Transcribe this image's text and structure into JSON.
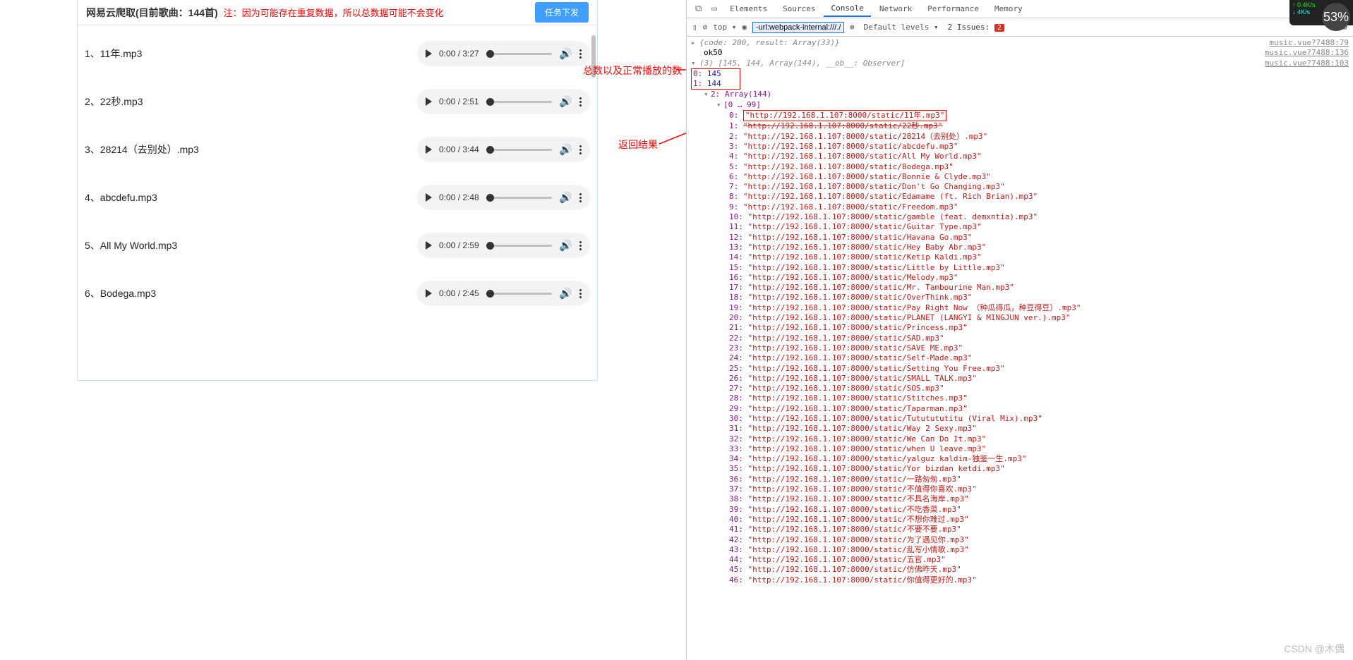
{
  "header": {
    "title_prefix": "网易云爬取(目前歌曲：",
    "count": "144",
    "title_suffix": "首)",
    "note": "注：因为可能存在重复数据，所以总数据可能不会变化",
    "button": "任务下发"
  },
  "songs": [
    {
      "idx": "1",
      "name": "11年.mp3",
      "time": "0:00 / 3:27"
    },
    {
      "idx": "2",
      "name": "22秒.mp3",
      "time": "0:00 / 2:51"
    },
    {
      "idx": "3",
      "name": "28214（去别处）.mp3",
      "time": "0:00 / 3:44"
    },
    {
      "idx": "4",
      "name": "abcdefu.mp3",
      "time": "0:00 / 2:48"
    },
    {
      "idx": "5",
      "name": "All My World.mp3",
      "time": "0:00 / 2:59"
    },
    {
      "idx": "6",
      "name": "Bodega.mp3",
      "time": "0:00 / 2:45"
    }
  ],
  "annotations": {
    "a1": "总数以及正常播放的数",
    "a2": "返回结果"
  },
  "devtools": {
    "tabs": [
      "Elements",
      "Sources",
      "Console",
      "Network",
      "Performance",
      "Memory"
    ],
    "active_tab": "Console",
    "toolbar": {
      "context": "top",
      "filter": "-url:webpack-internal:///./",
      "levels": "Default levels",
      "issues_label": "2 Issues:",
      "issues_count": "2"
    },
    "links": {
      "l1": "music.vue?7488:79",
      "l2": "music.vue?7488:136",
      "l3": "music.vue?7488:103"
    },
    "log1": "{code: 200, result: Array(33)}",
    "log2": "ok50",
    "log3_head": "(3) [145, 144, Array(144), __ob__: Observer]",
    "counts": {
      "k0": "0:",
      "v0": "145",
      "k1": "1:",
      "v1": "144",
      "k2": "2: Array(144)",
      "range": "[0 … 99]"
    },
    "urls": [
      {
        "i": "0",
        "u": "\"http://192.168.1.107:8000/static/11年.mp3\""
      },
      {
        "i": "1",
        "u": "\"http://192.168.1.107:8000/static/22秒.mp3\""
      },
      {
        "i": "2",
        "u": "\"http://192.168.1.107:8000/static/28214（去别处）.mp3\""
      },
      {
        "i": "3",
        "u": "\"http://192.168.1.107:8000/static/abcdefu.mp3\""
      },
      {
        "i": "4",
        "u": "\"http://192.168.1.107:8000/static/All My World.mp3\""
      },
      {
        "i": "5",
        "u": "\"http://192.168.1.107:8000/static/Bodega.mp3\""
      },
      {
        "i": "6",
        "u": "\"http://192.168.1.107:8000/static/Bonnie & Clyde.mp3\""
      },
      {
        "i": "7",
        "u": "\"http://192.168.1.107:8000/static/Don't Go Changing.mp3\""
      },
      {
        "i": "8",
        "u": "\"http://192.168.1.107:8000/static/Edamame (ft. Rich Brian).mp3\""
      },
      {
        "i": "9",
        "u": "\"http://192.168.1.107:8000/static/Freedom.mp3\""
      },
      {
        "i": "10",
        "u": "\"http://192.168.1.107:8000/static/gamble (feat. demxntia).mp3\""
      },
      {
        "i": "11",
        "u": "\"http://192.168.1.107:8000/static/Guitar Type.mp3\""
      },
      {
        "i": "12",
        "u": "\"http://192.168.1.107:8000/static/Havana Go.mp3\""
      },
      {
        "i": "13",
        "u": "\"http://192.168.1.107:8000/static/Hey Baby Abr.mp3\""
      },
      {
        "i": "14",
        "u": "\"http://192.168.1.107:8000/static/Ketip Kaldi.mp3\""
      },
      {
        "i": "15",
        "u": "\"http://192.168.1.107:8000/static/Little by Little.mp3\""
      },
      {
        "i": "16",
        "u": "\"http://192.168.1.107:8000/static/Melody.mp3\""
      },
      {
        "i": "17",
        "u": "\"http://192.168.1.107:8000/static/Mr. Tambourine Man.mp3\""
      },
      {
        "i": "18",
        "u": "\"http://192.168.1.107:8000/static/OverThink.mp3\""
      },
      {
        "i": "19",
        "u": "\"http://192.168.1.107:8000/static/Pay Right Now （种瓜得瓜，种豆得豆）.mp3\""
      },
      {
        "i": "20",
        "u": "\"http://192.168.1.107:8000/static/PLANET (LANGYI & MINGJUN ver.).mp3\""
      },
      {
        "i": "21",
        "u": "\"http://192.168.1.107:8000/static/Princess.mp3\""
      },
      {
        "i": "22",
        "u": "\"http://192.168.1.107:8000/static/SAD.mp3\""
      },
      {
        "i": "23",
        "u": "\"http://192.168.1.107:8000/static/SAVE ME.mp3\""
      },
      {
        "i": "24",
        "u": "\"http://192.168.1.107:8000/static/Self-Made.mp3\""
      },
      {
        "i": "25",
        "u": "\"http://192.168.1.107:8000/static/Setting You Free.mp3\""
      },
      {
        "i": "26",
        "u": "\"http://192.168.1.107:8000/static/SMALL TALK.mp3\""
      },
      {
        "i": "27",
        "u": "\"http://192.168.1.107:8000/static/SOS.mp3\""
      },
      {
        "i": "28",
        "u": "\"http://192.168.1.107:8000/static/Stitches.mp3\""
      },
      {
        "i": "29",
        "u": "\"http://192.168.1.107:8000/static/Taparman.mp3\""
      },
      {
        "i": "30",
        "u": "\"http://192.168.1.107:8000/static/Tututututitu (Viral Mix).mp3\""
      },
      {
        "i": "31",
        "u": "\"http://192.168.1.107:8000/static/Way 2 Sexy.mp3\""
      },
      {
        "i": "32",
        "u": "\"http://192.168.1.107:8000/static/We Can Do It.mp3\""
      },
      {
        "i": "33",
        "u": "\"http://192.168.1.107:8000/static/when U leave.mp3\""
      },
      {
        "i": "34",
        "u": "\"http://192.168.1.107:8000/static/yalguz kaldim-独鉴一生.mp3\""
      },
      {
        "i": "35",
        "u": "\"http://192.168.1.107:8000/static/Yor bizdan ketdi.mp3\""
      },
      {
        "i": "36",
        "u": "\"http://192.168.1.107:8000/static/一路匆匆.mp3\""
      },
      {
        "i": "37",
        "u": "\"http://192.168.1.107:8000/static/不值得你喜欢.mp3\""
      },
      {
        "i": "38",
        "u": "\"http://192.168.1.107:8000/static/不具名海岸.mp3\""
      },
      {
        "i": "39",
        "u": "\"http://192.168.1.107:8000/static/不吃香菜.mp3\""
      },
      {
        "i": "40",
        "u": "\"http://192.168.1.107:8000/static/不想你难过.mp3\""
      },
      {
        "i": "41",
        "u": "\"http://192.168.1.107:8000/static/不要不要.mp3\""
      },
      {
        "i": "42",
        "u": "\"http://192.168.1.107:8000/static/为了遇见你.mp3\""
      },
      {
        "i": "43",
        "u": "\"http://192.168.1.107:8000/static/乱写小情歌.mp3\""
      },
      {
        "i": "44",
        "u": "\"http://192.168.1.107:8000/static/五官.mp3\""
      },
      {
        "i": "45",
        "u": "\"http://192.168.1.107:8000/static/仿佛昨天.mp3\""
      },
      {
        "i": "46",
        "u": "\"http://192.168.1.107:8000/static/你值得更好的.mp3\""
      }
    ]
  },
  "speed": {
    "up": "0.4K/s",
    "down": "4K/s",
    "pct": "53%"
  },
  "watermark": "CSDN @木偶"
}
